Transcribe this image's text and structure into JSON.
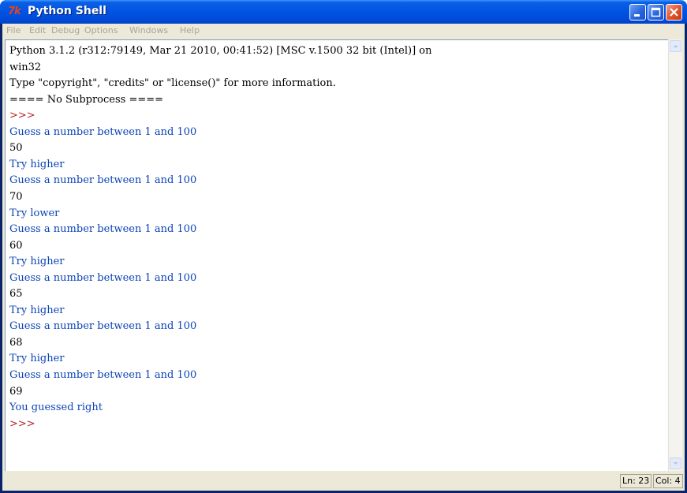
{
  "window": {
    "title": "Python Shell",
    "icon_text": "7k",
    "minimize_label": "minimize",
    "maximize_label": "maximize",
    "close_label": "close"
  },
  "menu": [
    "File",
    "Edit",
    "Debug",
    "Options",
    "Windows",
    "Help"
  ],
  "shell_lines": [
    {
      "text": "Python 3.1.2 (r312:79149, Mar 21 2010, 00:41:52) [MSC v.1500 32 bit (Intel)] on",
      "kind": "plain"
    },
    {
      "text": "win32",
      "kind": "plain"
    },
    {
      "text": "Type \"copyright\", \"credits\" or \"license()\" for more information.",
      "kind": "plain"
    },
    {
      "text": "==== No Subprocess ====",
      "kind": "plain"
    },
    {
      "text": ">>>",
      "kind": "prompt"
    },
    {
      "text": "Guess a number between 1 and 100",
      "kind": "out"
    },
    {
      "text": "50",
      "kind": "plain"
    },
    {
      "text": "Try higher",
      "kind": "out"
    },
    {
      "text": "Guess a number between 1 and 100",
      "kind": "out"
    },
    {
      "text": "70",
      "kind": "plain"
    },
    {
      "text": "Try lower",
      "kind": "out"
    },
    {
      "text": "Guess a number between 1 and 100",
      "kind": "out"
    },
    {
      "text": "60",
      "kind": "plain"
    },
    {
      "text": "Try higher",
      "kind": "out"
    },
    {
      "text": "Guess a number between 1 and 100",
      "kind": "out"
    },
    {
      "text": "65",
      "kind": "plain"
    },
    {
      "text": "Try higher",
      "kind": "out"
    },
    {
      "text": "Guess a number between 1 and 100",
      "kind": "out"
    },
    {
      "text": "68",
      "kind": "plain"
    },
    {
      "text": "Try higher",
      "kind": "out"
    },
    {
      "text": "Guess a number between 1 and 100",
      "kind": "out"
    },
    {
      "text": "69",
      "kind": "plain"
    },
    {
      "text": "You guessed right",
      "kind": "out"
    },
    {
      "text": ">>>",
      "kind": "prompt"
    }
  ],
  "status": {
    "line": "Ln: 23",
    "col": "Col: 4"
  },
  "colors": {
    "title_bar": "#0054e3",
    "output_text": "#0b44b6",
    "prompt_text": "#b22222",
    "input_text": "#000000"
  }
}
